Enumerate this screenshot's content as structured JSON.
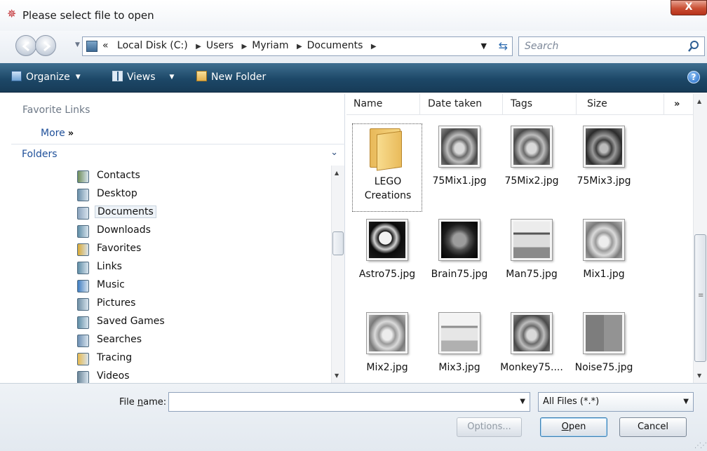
{
  "window": {
    "title": "Please select file to open",
    "close_label": "X"
  },
  "address": {
    "overflow": "«",
    "crumbs": [
      "Local Disk (C:)",
      "Users",
      "Myriam",
      "Documents"
    ],
    "search_placeholder": "Search"
  },
  "toolbar": {
    "organize": "Organize",
    "views": "Views",
    "new_folder": "New Folder",
    "help": "?"
  },
  "left": {
    "favorite_links": "Favorite Links",
    "more": "More",
    "more_glyph": "»",
    "folders": "Folders",
    "tree": [
      {
        "label": "Contacts",
        "icon": "contacts-folder-icon",
        "color": "#6f8d5a"
      },
      {
        "label": "Desktop",
        "icon": "desktop-folder-icon",
        "color": "#6a8fa9"
      },
      {
        "label": "Documents",
        "icon": "documents-folder-icon",
        "color": "#8aa3bd",
        "selected": true
      },
      {
        "label": "Downloads",
        "icon": "downloads-folder-icon",
        "color": "#5f8da6"
      },
      {
        "label": "Favorites",
        "icon": "favorites-folder-icon",
        "color": "#d9a935"
      },
      {
        "label": "Links",
        "icon": "links-folder-icon",
        "color": "#5f8da6"
      },
      {
        "label": "Music",
        "icon": "music-folder-icon",
        "color": "#3f7dc2"
      },
      {
        "label": "Pictures",
        "icon": "pictures-folder-icon",
        "color": "#6f8fa5"
      },
      {
        "label": "Saved Games",
        "icon": "saved-games-folder-icon",
        "color": "#5f8da6"
      },
      {
        "label": "Searches",
        "icon": "searches-folder-icon",
        "color": "#6c8fb3"
      },
      {
        "label": "Tracing",
        "icon": "tracing-folder-icon",
        "color": "#e6b94f"
      },
      {
        "label": "Videos",
        "icon": "videos-folder-icon",
        "color": "#6b8699"
      }
    ]
  },
  "columns": [
    "Name",
    "Date taken",
    "Tags",
    "Size"
  ],
  "columns_more": "»",
  "files": [
    {
      "label": "LEGO Creations",
      "kind": "folder"
    },
    {
      "label": "75Mix1.jpg",
      "kind": "image",
      "tone": "mandrill"
    },
    {
      "label": "75Mix2.jpg",
      "kind": "image",
      "tone": "mandrill"
    },
    {
      "label": "75Mix3.jpg",
      "kind": "image",
      "tone": "mandrill-dark"
    },
    {
      "label": "Astro75.jpg",
      "kind": "image",
      "tone": "astro"
    },
    {
      "label": "Brain75.jpg",
      "kind": "image",
      "tone": "brain"
    },
    {
      "label": "Man75.jpg",
      "kind": "image",
      "tone": "man"
    },
    {
      "label": "Mix1.jpg",
      "kind": "image",
      "tone": "mandrill-light"
    },
    {
      "label": "Mix2.jpg",
      "kind": "image",
      "tone": "mandrill-light"
    },
    {
      "label": "Mix3.jpg",
      "kind": "image",
      "tone": "man-light"
    },
    {
      "label": "Monkey75....",
      "kind": "image",
      "tone": "mandrill"
    },
    {
      "label": "Noise75.jpg",
      "kind": "image",
      "tone": "noise"
    }
  ],
  "bottom": {
    "file_name_label_pre": "File ",
    "file_name_label_u": "n",
    "file_name_label_post": "ame:",
    "file_name_value": "",
    "file_type": "All Files (*.*)",
    "options": "Options...",
    "open_u": "O",
    "open_rest": "pen",
    "cancel": "Cancel"
  }
}
